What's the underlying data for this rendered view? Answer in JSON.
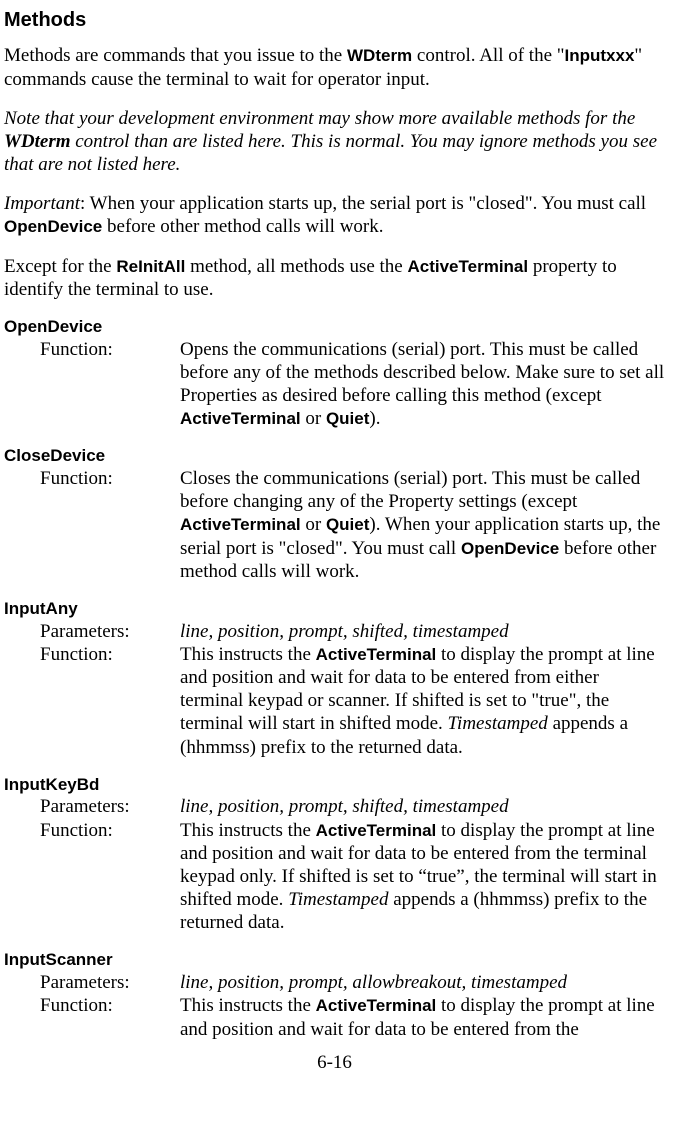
{
  "heading": "Methods",
  "intro": {
    "pre1": "Methods are commands that you issue to the ",
    "wdterm": "WDterm",
    "mid1": " control. All of the \"",
    "inputxxx": "Inputxxx",
    "post1": "\" commands cause the terminal to wait for operator input."
  },
  "note": {
    "pre": "Note that your development environment may show more available methods for the ",
    "wdterm": "WDterm",
    "post": " control than are listed here. This is normal. You may ignore methods you see that are not listed here."
  },
  "important": {
    "label": "Important",
    "mid1": ": When your application starts up, the serial port is \"closed\". You must call ",
    "opendevice": "OpenDevice",
    "post": " before other method calls will work."
  },
  "except": {
    "pre": "Except for the ",
    "reinit": "ReInitAll",
    "mid": " method, all methods use the ",
    "active": "ActiveTerminal",
    "post": " property to identify the terminal to use."
  },
  "labels": {
    "function": "Function:",
    "parameters": "Parameters:"
  },
  "open_device": {
    "name": "OpenDevice",
    "func": {
      "pre": "Opens the communications (serial) port. This must be called before any of the methods described below. Make sure to set all Properties as desired before calling this method (except ",
      "b1": "ActiveTerminal",
      "mid": " or ",
      "b2": "Quiet",
      "post": ")."
    }
  },
  "close_device": {
    "name": "CloseDevice",
    "func": {
      "pre": "Closes the communications (serial) port. This must be called before changing any of the Property settings (except ",
      "b1": "ActiveTerminal",
      "mid1": " or ",
      "b2": "Quiet",
      "mid2": "). When your application starts up, the serial port is \"closed\". You must call ",
      "b3": "OpenDevice",
      "post": " before other method calls will work."
    }
  },
  "input_any": {
    "name": "InputAny",
    "params": "line, position, prompt, shifted, timestamped",
    "func": {
      "pre": "This instructs the ",
      "b1": "ActiveTerminal",
      "mid1": " to display the prompt at line and position and wait for data to be entered from either terminal keypad or scanner. If shifted is set to \"true\", the terminal will start in shifted mode. ",
      "i1": "Timestamped",
      "post": " appends a (hhmmss) prefix to the returned data."
    }
  },
  "input_keybd": {
    "name": "InputKeyBd",
    "params": "line, position, prompt, shifted, timestamped",
    "func": {
      "pre": "This instructs the ",
      "b1": "ActiveTerminal",
      "mid1": " to display the prompt at line and position and wait for data to be entered from the terminal keypad only. If shifted is set to “true”, the terminal will start in shifted mode. ",
      "i1": "Timestamped",
      "post": " appends a (hhmmss) prefix to the returned data."
    }
  },
  "input_scanner": {
    "name": "InputScanner",
    "params": "line, position, prompt, allowbreakout, timestamped",
    "func": {
      "pre": "This instructs the ",
      "b1": "ActiveTerminal",
      "post": " to display the prompt at line and position and wait for data to be entered from the"
    }
  },
  "page_num": "6-16"
}
